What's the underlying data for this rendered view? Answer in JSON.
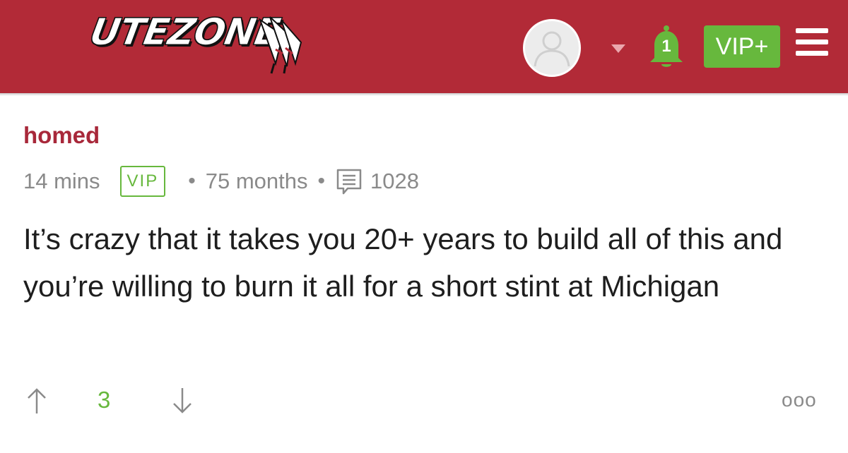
{
  "header": {
    "logo_text": "UTEZONE",
    "notification_count": "1",
    "vip_button_label": "VIP+"
  },
  "post": {
    "username": "homed",
    "time_ago": "14 mins",
    "badge": "VIP",
    "tenure": "75 months",
    "post_count": "1028",
    "body": "It’s crazy that it takes you 20+ years to build all of this and you’re willing to burn it all for a short stint at Michigan",
    "votes": "3",
    "more_label": "ooo"
  },
  "colors": {
    "header_bg": "#b22a37",
    "username": "#a8283a",
    "accent_green": "#67b83d",
    "muted_text": "#8a8a8a"
  },
  "icons": [
    "feathers-icon",
    "avatar-icon",
    "caret-down-icon",
    "bell-icon",
    "hamburger-menu-icon",
    "comment-icon",
    "arrow-up-icon",
    "arrow-down-icon"
  ]
}
